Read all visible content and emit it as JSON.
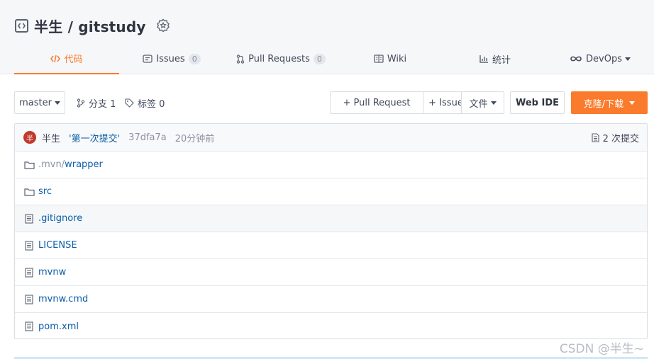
{
  "repo": {
    "owner": "半生",
    "separator": "/",
    "name": "gitstudy",
    "full": "半生 / gitstudy"
  },
  "tabs": [
    {
      "label": "代码",
      "icon": "code-icon",
      "active": true
    },
    {
      "label": "Issues",
      "icon": "issues-icon",
      "count": "0"
    },
    {
      "label": "Pull Requests",
      "icon": "pull-request-icon",
      "count": "0"
    },
    {
      "label": "Wiki",
      "icon": "wiki-icon"
    },
    {
      "label": "统计",
      "icon": "stats-icon"
    },
    {
      "label": "DevOps",
      "icon": "infinity-icon",
      "dropdown": true
    }
  ],
  "toolbar": {
    "branch": "master",
    "branches_label": "分支 1",
    "tags_label": "标签 0",
    "pull_request": "+ Pull Request",
    "issue": "+ Issue",
    "file": "文件",
    "webide": "Web IDE",
    "clone": "克隆/下载"
  },
  "commit": {
    "avatar_text": "半",
    "author": "半生",
    "message": "'第一次提交'",
    "hash": "37dfa7a",
    "time": "20分钟前",
    "count": "2 次提交"
  },
  "files": [
    {
      "type": "folder",
      "prefix": ".mvn/",
      "name": "wrapper"
    },
    {
      "type": "folder",
      "prefix": "",
      "name": "src"
    },
    {
      "type": "file",
      "prefix": "",
      "name": ".gitignore"
    },
    {
      "type": "file",
      "prefix": "",
      "name": "LICENSE"
    },
    {
      "type": "file",
      "prefix": "",
      "name": "mvnw"
    },
    {
      "type": "file",
      "prefix": "",
      "name": "mvnw.cmd"
    },
    {
      "type": "file",
      "prefix": "",
      "name": "pom.xml"
    }
  ],
  "watermark": "CSDN @半生~",
  "colors": {
    "accent": "#fa7b2c",
    "link": "#0b5ea8",
    "muted": "#8c92a4"
  }
}
